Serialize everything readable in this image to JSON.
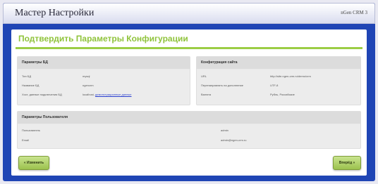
{
  "window": {
    "title": "Мастер Настройки",
    "product": "nGen CRM 3"
  },
  "page": {
    "title": "Подтвердить Параметры Конфигурации"
  },
  "db_box": {
    "title": "Параметры БД",
    "rows": [
      {
        "label": "Тип БД",
        "value": "mysql"
      },
      {
        "label": "Название БД",
        "value": "ngencrm"
      },
      {
        "label": "Хост, данные подключения БД",
        "value_prefix": "localhost,",
        "value_link": "демонстрационные данные"
      }
    ]
  },
  "site_box": {
    "title": "Конфигурация сайта",
    "rows": [
      {
        "label": "URL",
        "value": "http://site.ngen-crm.ru/demo/crm"
      },
      {
        "label": "Перенаправлять на дополнение",
        "value": "UTF-8"
      },
      {
        "label": "Валюта",
        "value": "Рубль, Российские"
      }
    ]
  },
  "admin_box": {
    "title": "Параметры Пользователя",
    "rows": [
      {
        "label": "Пользователь",
        "value": "admin"
      },
      {
        "label": "Email",
        "value": "admin@ngen-crm.ru"
      }
    ]
  },
  "buttons": {
    "back": "« Изменить",
    "next": "Вперёд »"
  }
}
